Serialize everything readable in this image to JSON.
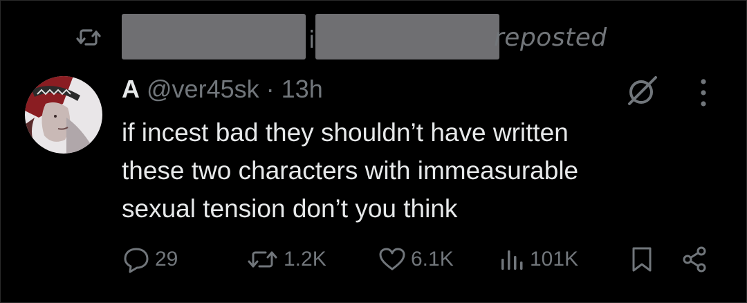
{
  "repost": {
    "label_tail": "reposted",
    "sliver_char": "i",
    "icon": "repost-icon"
  },
  "tweet": {
    "display_name": "A",
    "handle": "@ver45sk",
    "separator": "·",
    "time": "13h",
    "text": "if incest bad they shouldn’t have written\nthese two characters with immeasurable\nsexual tension don’t you think",
    "avatar": "avatar-image",
    "grok_icon": "grok-icon",
    "more_icon": "more-icon"
  },
  "actions": {
    "replies": "29",
    "reposts": "1.2K",
    "likes": "6.1K",
    "views": "101K",
    "bookmark_icon": "bookmark-icon",
    "share_icon": "share-icon"
  },
  "colors": {
    "background": "#000000",
    "text": "#e7e9ea",
    "muted": "#71767b",
    "redaction": "#6f6f72"
  }
}
